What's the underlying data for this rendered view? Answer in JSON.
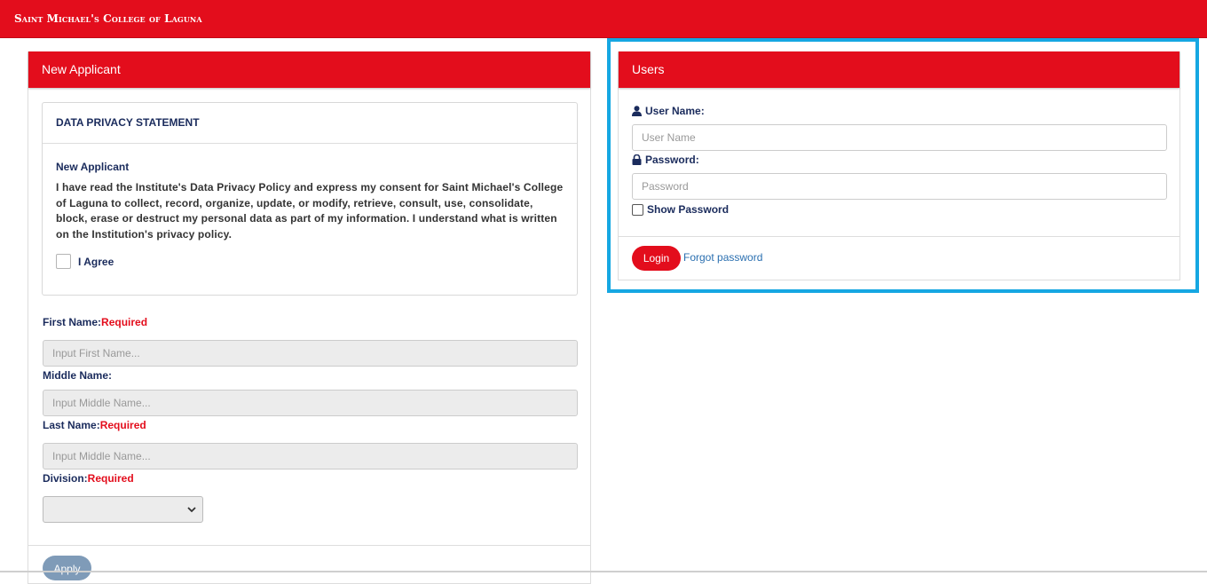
{
  "header": {
    "brand": "Saint Michael's College of Laguna",
    "color": "#e30d1c"
  },
  "new_applicant": {
    "panel_title": "New Applicant",
    "privacy": {
      "title": "DATA PRIVACY STATEMENT",
      "subtitle": "New Applicant",
      "text": "I have read the Institute's Data Privacy Policy and express my consent for Saint Michael's College of Laguna to collect, record, organize, update, or modify, retrieve, consult, use, consolidate, block, erase or destruct my personal data as part of my information. I understand what is written on the Institution's privacy policy.",
      "agree_label": "I Agree"
    },
    "first_name": {
      "label": "First Name:",
      "required": "Required",
      "placeholder": "Input First Name..."
    },
    "middle_name": {
      "label": "Middle Name:",
      "placeholder": "Input Middle Name..."
    },
    "last_name": {
      "label": "Last Name:",
      "required": "Required",
      "placeholder": "Input Middle Name..."
    },
    "division": {
      "label": "Division:",
      "required": "Required",
      "selected": ""
    },
    "apply_label": "Apply"
  },
  "users": {
    "panel_title": "Users",
    "username_label": "User Name:",
    "username_placeholder": "User Name",
    "password_label": "Password:",
    "password_placeholder": "Password",
    "show_password_label": "Show Password",
    "login_label": "Login",
    "forgot_label": "Forgot password"
  },
  "icons": {
    "user": "user-icon",
    "lock": "lock-icon",
    "chevron": "chevron-down-icon"
  },
  "colors": {
    "brand_red": "#e30d1c",
    "highlight_blue": "#15a7e2",
    "apply_disabled": "#7f9bb8",
    "label_navy": "#1a2b5c"
  }
}
